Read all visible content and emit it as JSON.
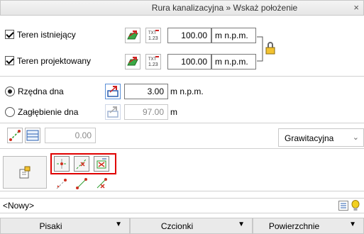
{
  "window": {
    "title": "Rura kanalizacyjna » Wskaż położenie",
    "close_glyph": "×"
  },
  "terrain": {
    "existing": {
      "label": "Teren istniejący",
      "checked": true,
      "value": "100.00",
      "unit": "m n.p.m."
    },
    "designed": {
      "label": "Teren projektowany",
      "checked": true,
      "value": "100.00",
      "unit": "m n.p.m."
    },
    "table_icon_text": "TXT\n1.23"
  },
  "bottom": {
    "ordinate": {
      "label": "Rzędna dna",
      "selected": true,
      "value": "3.00",
      "unit": "m n.p.m."
    },
    "depth": {
      "label": "Zagłębienie dna",
      "selected": false,
      "value": "97.00",
      "unit": "m"
    }
  },
  "slope": {
    "value": "0.00",
    "flow_type": "Grawitacyjna"
  },
  "layer": {
    "value": "<Nowy>"
  },
  "tabs": [
    {
      "label": "Pisaki"
    },
    {
      "label": "Czcionki"
    },
    {
      "label": "Powierzchnie"
    }
  ],
  "colors": {
    "highlight_border": "#e00000",
    "accent_green": "#2e9e2e",
    "accent_red": "#d03020"
  }
}
